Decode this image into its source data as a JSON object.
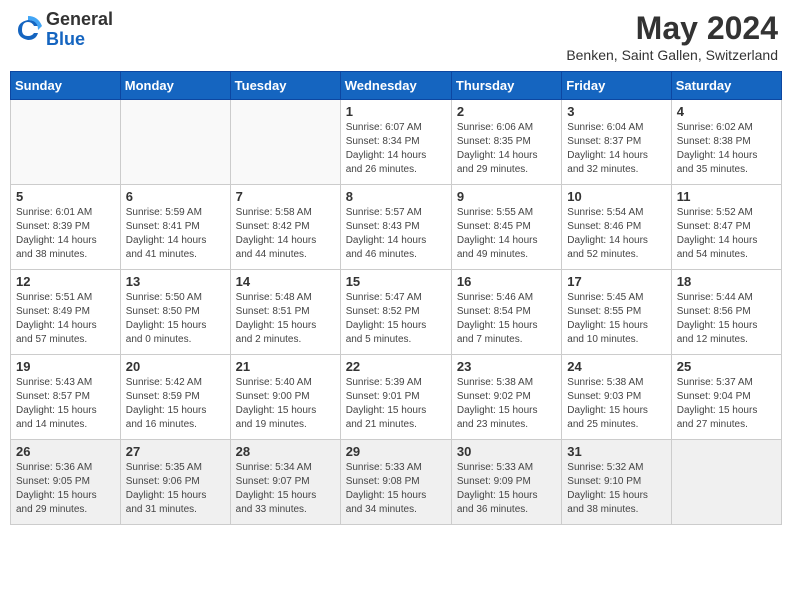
{
  "header": {
    "logo_general": "General",
    "logo_blue": "Blue",
    "main_title": "May 2024",
    "subtitle": "Benken, Saint Gallen, Switzerland"
  },
  "weekdays": [
    "Sunday",
    "Monday",
    "Tuesday",
    "Wednesday",
    "Thursday",
    "Friday",
    "Saturday"
  ],
  "weeks": [
    [
      {
        "day": "",
        "info": ""
      },
      {
        "day": "",
        "info": ""
      },
      {
        "day": "",
        "info": ""
      },
      {
        "day": "1",
        "info": "Sunrise: 6:07 AM\nSunset: 8:34 PM\nDaylight: 14 hours\nand 26 minutes."
      },
      {
        "day": "2",
        "info": "Sunrise: 6:06 AM\nSunset: 8:35 PM\nDaylight: 14 hours\nand 29 minutes."
      },
      {
        "day": "3",
        "info": "Sunrise: 6:04 AM\nSunset: 8:37 PM\nDaylight: 14 hours\nand 32 minutes."
      },
      {
        "day": "4",
        "info": "Sunrise: 6:02 AM\nSunset: 8:38 PM\nDaylight: 14 hours\nand 35 minutes."
      }
    ],
    [
      {
        "day": "5",
        "info": "Sunrise: 6:01 AM\nSunset: 8:39 PM\nDaylight: 14 hours\nand 38 minutes."
      },
      {
        "day": "6",
        "info": "Sunrise: 5:59 AM\nSunset: 8:41 PM\nDaylight: 14 hours\nand 41 minutes."
      },
      {
        "day": "7",
        "info": "Sunrise: 5:58 AM\nSunset: 8:42 PM\nDaylight: 14 hours\nand 44 minutes."
      },
      {
        "day": "8",
        "info": "Sunrise: 5:57 AM\nSunset: 8:43 PM\nDaylight: 14 hours\nand 46 minutes."
      },
      {
        "day": "9",
        "info": "Sunrise: 5:55 AM\nSunset: 8:45 PM\nDaylight: 14 hours\nand 49 minutes."
      },
      {
        "day": "10",
        "info": "Sunrise: 5:54 AM\nSunset: 8:46 PM\nDaylight: 14 hours\nand 52 minutes."
      },
      {
        "day": "11",
        "info": "Sunrise: 5:52 AM\nSunset: 8:47 PM\nDaylight: 14 hours\nand 54 minutes."
      }
    ],
    [
      {
        "day": "12",
        "info": "Sunrise: 5:51 AM\nSunset: 8:49 PM\nDaylight: 14 hours\nand 57 minutes."
      },
      {
        "day": "13",
        "info": "Sunrise: 5:50 AM\nSunset: 8:50 PM\nDaylight: 15 hours\nand 0 minutes."
      },
      {
        "day": "14",
        "info": "Sunrise: 5:48 AM\nSunset: 8:51 PM\nDaylight: 15 hours\nand 2 minutes."
      },
      {
        "day": "15",
        "info": "Sunrise: 5:47 AM\nSunset: 8:52 PM\nDaylight: 15 hours\nand 5 minutes."
      },
      {
        "day": "16",
        "info": "Sunrise: 5:46 AM\nSunset: 8:54 PM\nDaylight: 15 hours\nand 7 minutes."
      },
      {
        "day": "17",
        "info": "Sunrise: 5:45 AM\nSunset: 8:55 PM\nDaylight: 15 hours\nand 10 minutes."
      },
      {
        "day": "18",
        "info": "Sunrise: 5:44 AM\nSunset: 8:56 PM\nDaylight: 15 hours\nand 12 minutes."
      }
    ],
    [
      {
        "day": "19",
        "info": "Sunrise: 5:43 AM\nSunset: 8:57 PM\nDaylight: 15 hours\nand 14 minutes."
      },
      {
        "day": "20",
        "info": "Sunrise: 5:42 AM\nSunset: 8:59 PM\nDaylight: 15 hours\nand 16 minutes."
      },
      {
        "day": "21",
        "info": "Sunrise: 5:40 AM\nSunset: 9:00 PM\nDaylight: 15 hours\nand 19 minutes."
      },
      {
        "day": "22",
        "info": "Sunrise: 5:39 AM\nSunset: 9:01 PM\nDaylight: 15 hours\nand 21 minutes."
      },
      {
        "day": "23",
        "info": "Sunrise: 5:38 AM\nSunset: 9:02 PM\nDaylight: 15 hours\nand 23 minutes."
      },
      {
        "day": "24",
        "info": "Sunrise: 5:38 AM\nSunset: 9:03 PM\nDaylight: 15 hours\nand 25 minutes."
      },
      {
        "day": "25",
        "info": "Sunrise: 5:37 AM\nSunset: 9:04 PM\nDaylight: 15 hours\nand 27 minutes."
      }
    ],
    [
      {
        "day": "26",
        "info": "Sunrise: 5:36 AM\nSunset: 9:05 PM\nDaylight: 15 hours\nand 29 minutes."
      },
      {
        "day": "27",
        "info": "Sunrise: 5:35 AM\nSunset: 9:06 PM\nDaylight: 15 hours\nand 31 minutes."
      },
      {
        "day": "28",
        "info": "Sunrise: 5:34 AM\nSunset: 9:07 PM\nDaylight: 15 hours\nand 33 minutes."
      },
      {
        "day": "29",
        "info": "Sunrise: 5:33 AM\nSunset: 9:08 PM\nDaylight: 15 hours\nand 34 minutes."
      },
      {
        "day": "30",
        "info": "Sunrise: 5:33 AM\nSunset: 9:09 PM\nDaylight: 15 hours\nand 36 minutes."
      },
      {
        "day": "31",
        "info": "Sunrise: 5:32 AM\nSunset: 9:10 PM\nDaylight: 15 hours\nand 38 minutes."
      },
      {
        "day": "",
        "info": ""
      }
    ]
  ]
}
